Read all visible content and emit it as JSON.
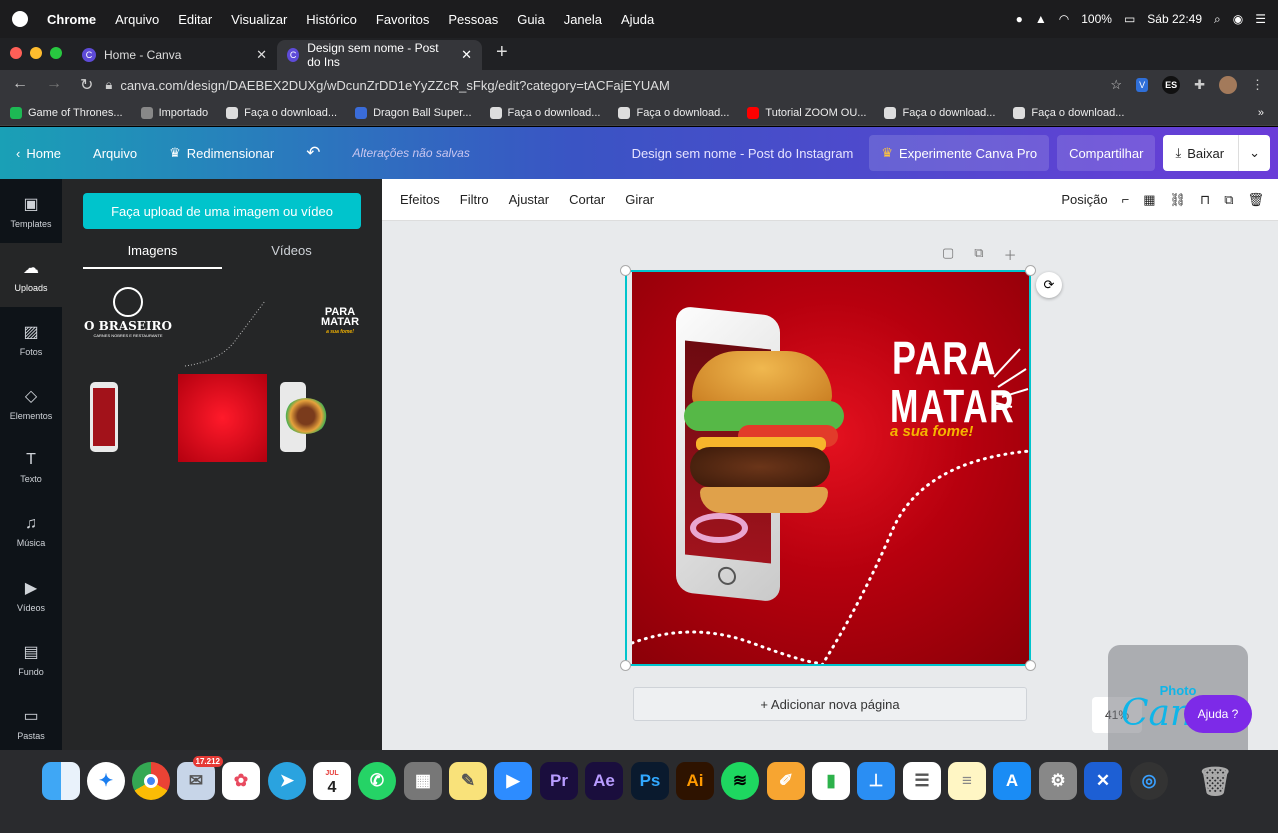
{
  "menubar": {
    "app": "Chrome",
    "items": [
      "Arquivo",
      "Editar",
      "Visualizar",
      "Histórico",
      "Favoritos",
      "Pessoas",
      "Guia",
      "Janela",
      "Ajuda"
    ],
    "battery": "100%",
    "clock": "Sáb 22:49"
  },
  "tabs": [
    {
      "title": "Home - Canva"
    },
    {
      "title": "Design sem nome - Post do Ins"
    }
  ],
  "address": {
    "url": "canva.com/design/DAEBEX2DUXg/wDcunZrDD1eYyZZcR_sFkg/edit?category=tACFajEYUAM"
  },
  "bookmarks": [
    {
      "label": "Game of Thrones...",
      "color": "#1db954"
    },
    {
      "label": "Importado",
      "color": "#888888"
    },
    {
      "label": "Faça o download...",
      "color": "#dddddd"
    },
    {
      "label": "Dragon Ball Super...",
      "color": "#3a6cd9"
    },
    {
      "label": "Faça o download...",
      "color": "#dddddd"
    },
    {
      "label": "Faça o download...",
      "color": "#dddddd"
    },
    {
      "label": "Tutorial ZOOM OU...",
      "color": "#ff0000"
    },
    {
      "label": "Faça o download...",
      "color": "#dddddd"
    },
    {
      "label": "Faça o download...",
      "color": "#dddddd"
    }
  ],
  "canva": {
    "home": "Home",
    "file": "Arquivo",
    "resize": "Redimensionar",
    "unsaved": "Alterações não salvas",
    "title": "Design sem nome - Post do Instagram",
    "pro": "Experimente Canva Pro",
    "share": "Compartilhar",
    "download": "Baixar",
    "sidebar": [
      "Templates",
      "Uploads",
      "Fotos",
      "Elementos",
      "Texto",
      "Música",
      "Vídeos",
      "Fundo",
      "Pastas"
    ],
    "upload_button": "Faça upload de uma imagem ou vídeo",
    "panel_tabs": [
      "Imagens",
      "Vídeos"
    ],
    "thumb_logo": {
      "title": "O BRASEIRO",
      "subtitle": "CARNES NOBRES E RESTAURANTE"
    },
    "thumb_para": [
      "PARA",
      "MATAR",
      "a sua fome!"
    ],
    "toolbar": [
      "Efeitos",
      "Filtro",
      "Ajustar",
      "Cortar",
      "Girar"
    ],
    "position": "Posição",
    "design_text": {
      "line1": "PARA",
      "line2": "MATAR",
      "line3": "a sua fome!"
    },
    "add_page": "+ Adicionar nova página",
    "zoom": "41%",
    "help": "Ajuda ?",
    "watermark": {
      "top": "Photo",
      "bottom": "Canva"
    }
  },
  "dock": {
    "mail_badge": "17.212",
    "calendar_month": "JUL",
    "calendar_day": "4",
    "apps": [
      "Pr",
      "Ae",
      "Ps",
      "Ai"
    ]
  }
}
